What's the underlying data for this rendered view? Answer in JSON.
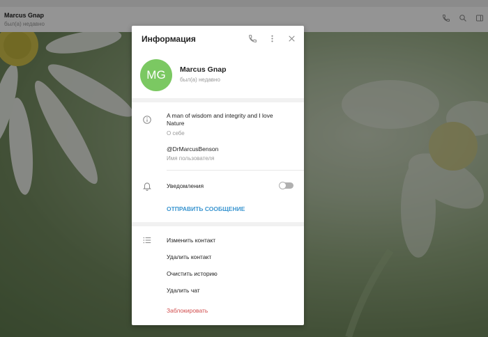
{
  "header": {
    "title": "Marcus Gnap",
    "status": "был(а) недавно"
  },
  "modal": {
    "title": "Информация",
    "profile": {
      "initials": "MG",
      "name": "Marcus Gnap",
      "status": "был(а) недавно",
      "avatar_color": "#7bc862"
    },
    "bio": {
      "text": "A man of wisdom and integrity and I love Nature",
      "label": "О себе"
    },
    "username": {
      "value": "@DrMarcusBenson",
      "label": "Имя пользователя"
    },
    "notifications": {
      "label": "Уведомления",
      "enabled": false
    },
    "send_message_label": "ОТПРАВИТЬ СООБЩЕНИЕ",
    "actions": [
      {
        "label": "Изменить контакт"
      },
      {
        "label": "Удалить контакт"
      },
      {
        "label": "Очистить историю"
      },
      {
        "label": "Удалить чат"
      },
      {
        "label": "Заблокировать"
      }
    ]
  },
  "colors": {
    "accent": "#3a95d0",
    "danger": "#d14d4d",
    "icon": "#8a8a8a"
  },
  "icons": [
    "phone-icon",
    "search-icon",
    "sidebar-toggle-icon",
    "more-vertical-icon",
    "close-icon",
    "info-icon",
    "bell-icon",
    "list-icon"
  ]
}
